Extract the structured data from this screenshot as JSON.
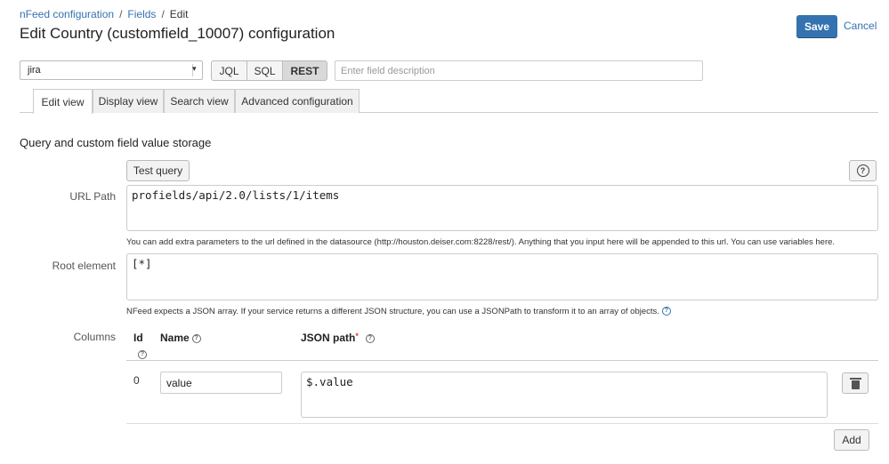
{
  "breadcrumb": {
    "items": [
      "nFeed configuration",
      "Fields",
      "Edit"
    ]
  },
  "page_title": "Edit Country (customfield_10007) configuration",
  "actions": {
    "save_label": "Save",
    "cancel_label": "Cancel"
  },
  "datasource": {
    "selected": "jira"
  },
  "query_type": {
    "options": [
      "JQL",
      "SQL",
      "REST"
    ],
    "selected": "REST"
  },
  "field_description": {
    "placeholder": "Enter field description",
    "value": ""
  },
  "tabs": [
    {
      "label": "Edit view",
      "active": true
    },
    {
      "label": "Display view",
      "active": false
    },
    {
      "label": "Search view",
      "active": false
    },
    {
      "label": "Advanced configuration",
      "active": false
    }
  ],
  "section": {
    "title": "Query and custom field value storage",
    "test_query_label": "Test query",
    "url_path": {
      "label": "URL Path",
      "value": "profields/api/2.0/lists/1/items",
      "hint": "You can add extra parameters to the url defined in the datasource (http://houston.deiser.com:8228/rest/). Anything that you input here will be appended to this url. You can use variables here."
    },
    "root_element": {
      "label": "Root element",
      "value": "[*]",
      "hint": "NFeed expects a JSON array. If your service returns a different JSON structure, you can use a JSONPath to transform it to an array of objects."
    },
    "columns": {
      "label": "Columns",
      "headers": {
        "id": "Id",
        "name": "Name",
        "json_path": "JSON path"
      },
      "rows": [
        {
          "id": "0",
          "name": "value",
          "json_path": "$.value"
        }
      ],
      "add_label": "Add"
    }
  },
  "colors": {
    "accent": "#3572b0",
    "required": "#d04437"
  },
  "icons": {
    "help": "question-circle-icon",
    "delete": "trash-icon",
    "dropdown": "chevron-down-icon"
  }
}
